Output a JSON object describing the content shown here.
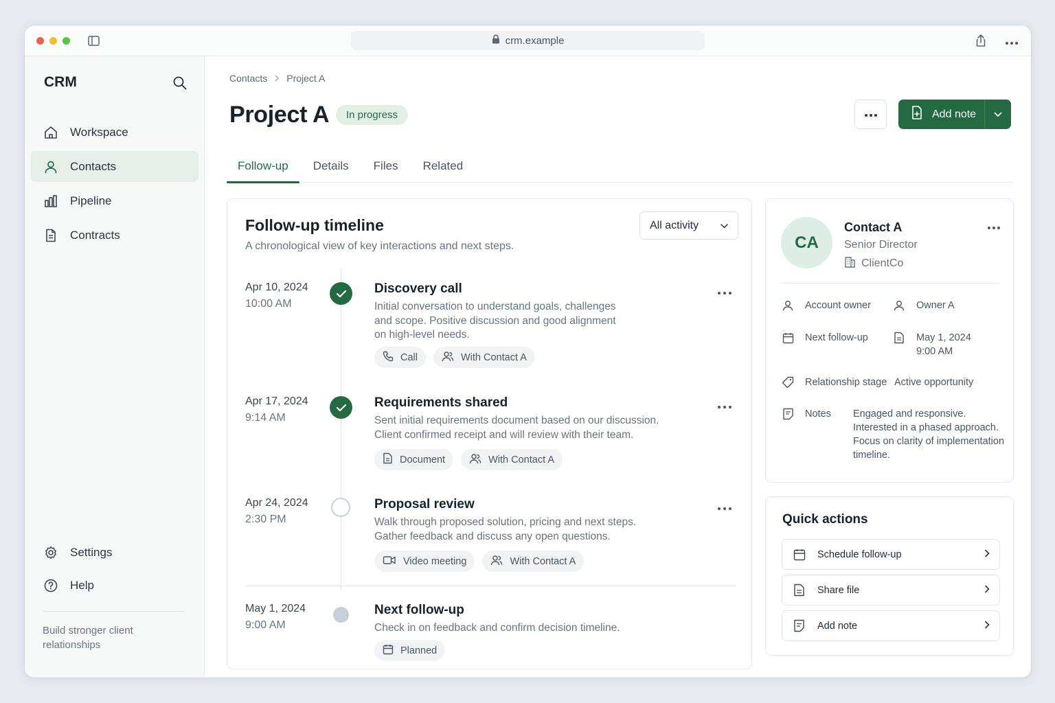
{
  "browser": {
    "url": "crm.example"
  },
  "sidebar": {
    "brand": "CRM",
    "items": [
      {
        "label": "Workspace",
        "icon": "home-icon"
      },
      {
        "label": "Contacts",
        "icon": "user-icon",
        "active": true
      },
      {
        "label": "Pipeline",
        "icon": "bar-chart-icon"
      },
      {
        "label": "Contracts",
        "icon": "document-icon"
      }
    ],
    "bottom_items": [
      {
        "label": "Settings",
        "icon": "gear-icon"
      },
      {
        "label": "Help",
        "icon": "help-icon"
      }
    ],
    "tagline": "Build stronger client relationships"
  },
  "breadcrumb": [
    "Contacts",
    "Project A"
  ],
  "header": {
    "title": "Project A",
    "status": "In progress",
    "add_note_label": "Add note"
  },
  "tabs": [
    "Follow-up",
    "Details",
    "Files",
    "Related"
  ],
  "timeline": {
    "title": "Follow-up timeline",
    "subtitle": "A chronological view of key interactions and next steps.",
    "filter": "All activity",
    "entries": [
      {
        "date": "Apr 10, 2024",
        "time": "10:00 AM",
        "title": "Discovery call",
        "state": "done",
        "desc": [
          "Initial conversation to understand goals, challenges",
          "and scope. Positive discussion and good alignment",
          "on high-level needs."
        ],
        "chips": [
          "Call",
          "With Contact A"
        ]
      },
      {
        "date": "Apr 17, 2024",
        "time": "9:14 AM",
        "title": "Requirements shared",
        "state": "done",
        "desc": [
          "Sent initial requirements document based on our discussion.",
          "Client confirmed receipt and will review with their team."
        ],
        "chips": [
          "Document",
          "With Contact A"
        ]
      },
      {
        "date": "Apr 24, 2024",
        "time": "2:30 PM",
        "title": "Proposal review",
        "state": "pending",
        "desc": [
          "Walk through proposed solution, pricing and next steps.",
          "Gather feedback and discuss any open questions."
        ],
        "chips": [
          "Video meeting",
          "With Contact A"
        ]
      },
      {
        "date": "May 1, 2024",
        "time": "9:00 AM",
        "title": "Next follow-up",
        "state": "planned",
        "desc": [
          "Check in on feedback and confirm decision timeline."
        ],
        "chips": [
          "Planned"
        ]
      }
    ]
  },
  "contact": {
    "initials": "CA",
    "name": "Contact A",
    "role": "Senior Director",
    "company": "ClientCo",
    "fields": {
      "account_owner_label": "Account owner",
      "account_owner_value": "Owner A",
      "next_followup_label": "Next follow-up",
      "next_followup_date": "May 1, 2024",
      "next_followup_time": "9:00 AM",
      "stage_label": "Relationship stage",
      "stage_value": "Active opportunity",
      "notes_label": "Notes",
      "notes_value": [
        "Engaged and responsive.",
        "Interested in a phased approach.",
        "Focus on clarity of implementation",
        "timeline."
      ]
    }
  },
  "quick_actions": {
    "title": "Quick actions",
    "items": [
      "Schedule follow-up",
      "Share file",
      "Add note"
    ]
  },
  "colors": {
    "accent": "#236a43",
    "accent_soft": "#e1efe6",
    "muted_text": "#6a747d"
  }
}
